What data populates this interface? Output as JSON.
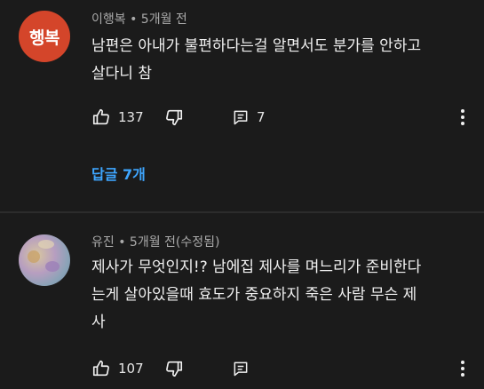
{
  "comments": [
    {
      "avatar_text": "행복",
      "avatar_color": "#d4452a",
      "meta": "이행복 • 5개월 전",
      "lines": [
        "남편은 아내가 불편하다는걸 알면서도 분가를 안하고",
        "살다니 참"
      ],
      "like_count": "137",
      "reply_count": "7",
      "replies_link": "답글 7개"
    },
    {
      "meta": "유진 • 5개월 전(수정됨)",
      "lines": [
        "제사가 무엇인지!? 남에집 제사를 며느리가 준비한다",
        "는게 살아있을때 효도가 중요하지 죽은 사람 무슨 제",
        "사"
      ],
      "like_count": "107"
    }
  ],
  "icons": {
    "like": "thumbs-up-icon",
    "dislike": "thumbs-down-icon",
    "reply": "reply-icon",
    "more": "more-vertical-icon"
  },
  "colors": {
    "background": "#1b1b1b",
    "link": "#3ea6ff",
    "meta": "#aaaaaa"
  }
}
